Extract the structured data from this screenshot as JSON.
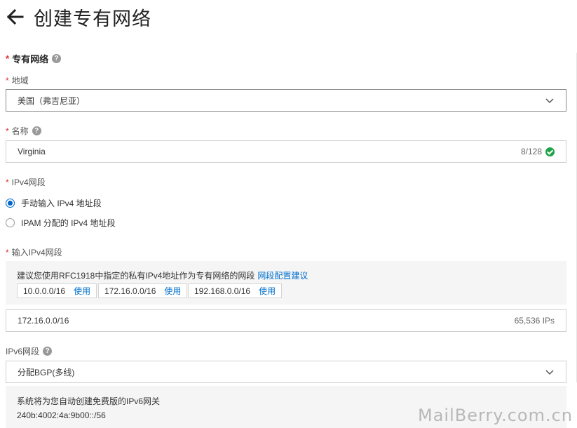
{
  "header": {
    "title": "创建专有网络"
  },
  "section": {
    "title": "专有网络",
    "required_mark": "*",
    "help": "?"
  },
  "region": {
    "label": "地域",
    "value": "美国（弗吉尼亚）"
  },
  "name": {
    "label": "名称",
    "value": "Virginia",
    "counter": "8/128"
  },
  "ipv4_mode": {
    "label": "IPv4网段",
    "options": [
      {
        "label": "手动输入 IPv4 地址段",
        "checked": true
      },
      {
        "label": "IPAM 分配的 IPv4 地址段",
        "checked": false
      }
    ]
  },
  "ipv4_input": {
    "label": "输入IPv4网段",
    "hint": "建议您使用RFC1918中指定的私有IPv4地址作为专有网络的网段",
    "hint_link": "网段配置建议",
    "suggestions": [
      {
        "cidr": "10.0.0.0/16",
        "action": "使用"
      },
      {
        "cidr": "172.16.0.0/16",
        "action": "使用"
      },
      {
        "cidr": "192.168.0.0/16",
        "action": "使用"
      }
    ],
    "value": "172.16.0.0/16",
    "ip_count": "65,536 IPs"
  },
  "ipv6": {
    "label": "IPv6网段",
    "value": "分配BGP(多线)",
    "note": "系统将为您自动创建免费版的IPv6网关",
    "cidr": "240b:4002:4a:9b00::/56"
  },
  "watermark": "MailBerry.com.cn",
  "colors": {
    "accent": "#0064c8",
    "link": "#0070cc",
    "required": "#d93026",
    "success": "#1fa34a"
  }
}
